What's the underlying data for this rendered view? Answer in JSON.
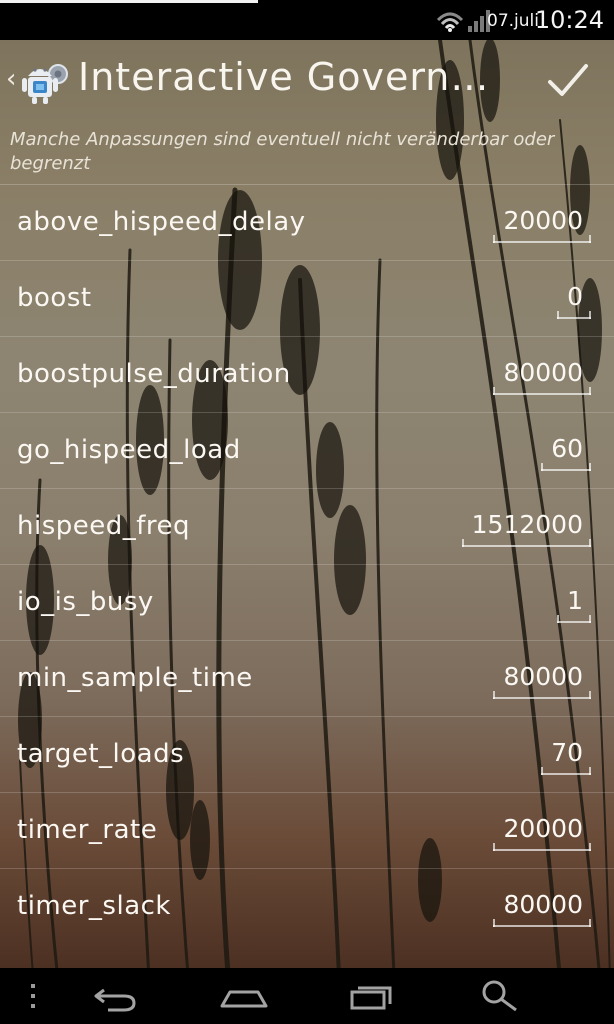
{
  "status_bar": {
    "date": "07.juli",
    "time": "10:24",
    "icons": [
      "wifi-icon",
      "signal-icon"
    ]
  },
  "action_bar": {
    "title": "Interactive Govern…",
    "back_icon": "chevron-left-icon",
    "app_icon": "android-settings-icon",
    "done_icon": "checkmark-icon"
  },
  "notice": "Manche Anpassungen sind eventuell nicht veränderbar oder begrenzt",
  "settings": [
    {
      "name": "above_hispeed_delay",
      "value": "20000"
    },
    {
      "name": "boost",
      "value": "0"
    },
    {
      "name": "boostpulse_duration",
      "value": "80000"
    },
    {
      "name": "go_hispeed_load",
      "value": "60"
    },
    {
      "name": "hispeed_freq",
      "value": "1512000"
    },
    {
      "name": "io_is_busy",
      "value": "1"
    },
    {
      "name": "min_sample_time",
      "value": "80000"
    },
    {
      "name": "target_loads",
      "value": "70"
    },
    {
      "name": "timer_rate",
      "value": "20000"
    },
    {
      "name": "timer_slack",
      "value": "80000"
    }
  ],
  "nav_bar": {
    "items": [
      "menu-icon",
      "back-icon",
      "home-icon",
      "recents-icon",
      "search-icon"
    ]
  },
  "colors": {
    "background_top": "#7b715a",
    "background_bottom": "#3f2418",
    "text": "#fbf8f3"
  }
}
